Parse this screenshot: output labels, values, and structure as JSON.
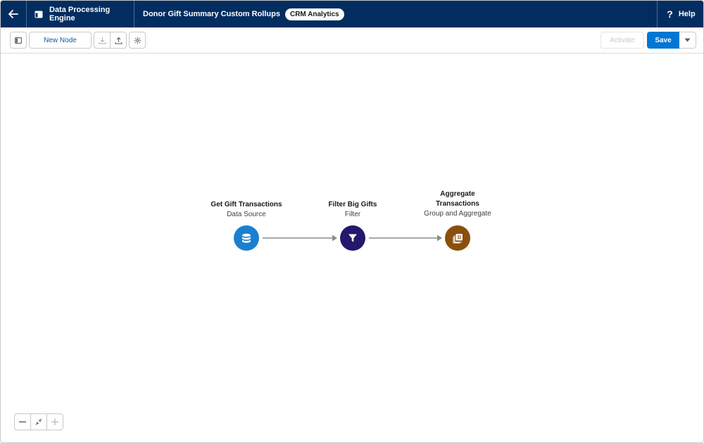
{
  "header": {
    "app_name": "Data Processing Engine",
    "title": "Donor Gift Summary Custom Rollups",
    "badge": "CRM Analytics",
    "help_label": "Help",
    "help_icon": "?"
  },
  "toolbar": {
    "new_node_label": "New Node",
    "activate_label": "Activate",
    "save_label": "Save"
  },
  "nodes": [
    {
      "label": "Get Gift Transactions",
      "type": "Data Source",
      "icon": "database-icon",
      "color": "#1b7fd1"
    },
    {
      "label": "Filter Big Gifts",
      "type": "Filter",
      "icon": "filter-icon",
      "color": "#22196c"
    },
    {
      "label_line1": "Aggregate",
      "label_line2": "Transactions",
      "type": "Group and Aggregate",
      "icon": "aggregate-icon",
      "color": "#8a4f0c"
    }
  ],
  "colors": {
    "header_bg": "#032d60",
    "primary": "#0176d3",
    "connector": "#8c8c8c"
  }
}
